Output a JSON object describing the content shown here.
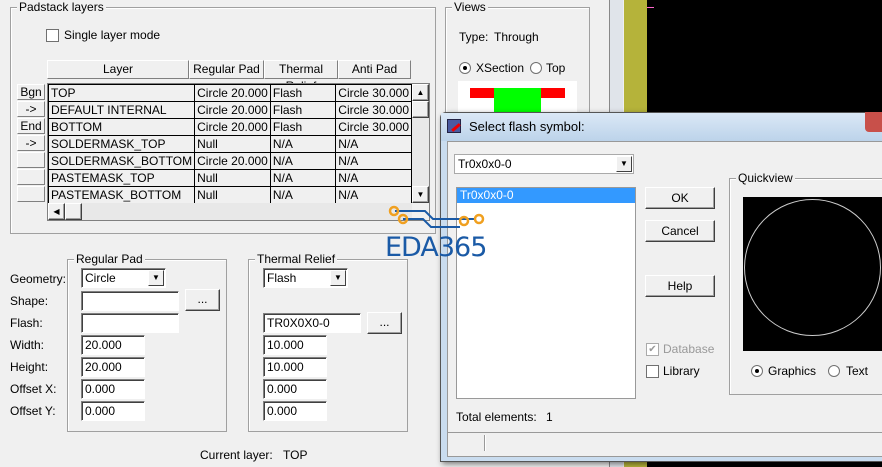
{
  "padstack": {
    "group_title": "Padstack layers",
    "single_layer_mode": "Single layer mode",
    "columns": [
      "Layer",
      "Regular Pad",
      "Thermal Relief",
      "Anti Pad"
    ],
    "row_buttons": [
      "Bgn",
      "->",
      "End",
      "->",
      "",
      "",
      ""
    ],
    "rows": [
      [
        "TOP",
        "Circle 20.000",
        "Flash",
        "Circle 30.000"
      ],
      [
        "DEFAULT INTERNAL",
        "Circle 20.000",
        "Flash",
        "Circle 30.000"
      ],
      [
        "BOTTOM",
        "Circle 20.000",
        "Flash",
        "Circle 30.000"
      ],
      [
        "SOLDERMASK_TOP",
        "Null",
        "N/A",
        "N/A"
      ],
      [
        "SOLDERMASK_BOTTOM",
        "Circle 20.000",
        "N/A",
        "N/A"
      ],
      [
        "PASTEMASK_TOP",
        "Null",
        "N/A",
        "N/A"
      ],
      [
        "PASTEMASK_BOTTOM",
        "Null",
        "N/A",
        "N/A"
      ]
    ]
  },
  "views": {
    "title": "Views",
    "type_label": "Type:",
    "type_value": "Through",
    "xsection": "XSection",
    "top": "Top"
  },
  "labels": {
    "geometry": "Geometry:",
    "shape": "Shape:",
    "flash": "Flash:",
    "width": "Width:",
    "height": "Height:",
    "offx": "Offset X:",
    "offy": "Offset Y:"
  },
  "regular_pad": {
    "title": "Regular Pad",
    "geometry": "Circle",
    "shape": "",
    "flash": "",
    "width": "20.000",
    "height": "20.000",
    "offx": "0.000",
    "offy": "0.000",
    "browse": "..."
  },
  "thermal": {
    "title": "Thermal Relief",
    "geometry": "Flash",
    "flash": "TR0X0X0-0",
    "width": "10.000",
    "height": "10.000",
    "offx": "0.000",
    "offy": "0.000",
    "browse": "..."
  },
  "current_layer": {
    "label": "Current layer:",
    "value": "TOP"
  },
  "dialog": {
    "title": "Select flash symbol:",
    "combo": "Tr0x0x0-0",
    "list": [
      "Tr0x0x0-0"
    ],
    "ok": "OK",
    "cancel": "Cancel",
    "help": "Help",
    "database": "Database",
    "library": "Library",
    "quickview": "Quickview",
    "graphics": "Graphics",
    "text": "Text",
    "total_label": "Total elements:",
    "total_value": "1"
  },
  "watermark": "EDA365"
}
